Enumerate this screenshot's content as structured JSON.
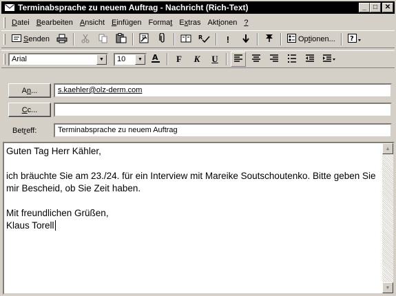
{
  "window": {
    "title": "Terminabsprache zu neuem Auftrag - Nachricht (Rich-Text)",
    "controls": {
      "minimize": "_",
      "maximize": "□",
      "close": "✕"
    }
  },
  "menu": [
    {
      "pre": "",
      "acc": "D",
      "post": "atei"
    },
    {
      "pre": "",
      "acc": "B",
      "post": "earbeiten"
    },
    {
      "pre": "",
      "acc": "A",
      "post": "nsicht"
    },
    {
      "pre": "",
      "acc": "E",
      "post": "infügen"
    },
    {
      "pre": "Forma",
      "acc": "t",
      "post": ""
    },
    {
      "pre": "E",
      "acc": "x",
      "post": "tras"
    },
    {
      "pre": "Akt",
      "acc": "i",
      "post": "onen"
    },
    {
      "pre": "",
      "acc": "?",
      "post": ""
    }
  ],
  "toolbar": {
    "send_pre": "",
    "send_acc": "S",
    "send_post": "enden",
    "options_pre": "Op",
    "options_acc": "t",
    "options_post": "ionen..."
  },
  "format": {
    "font": "Arial",
    "size": "10",
    "bold": "F",
    "italic": "K",
    "underline": "U"
  },
  "header": {
    "to_pre": "A",
    "to_acc": "n",
    "to_post": "...",
    "to_value": "s.kaehler@olz-derm.com",
    "cc_pre": "",
    "cc_acc": "C",
    "cc_post": "c...",
    "cc_value": "",
    "subject_pre": "Bet",
    "subject_acc": "r",
    "subject_post": "eff:",
    "subject_value": "Terminabsprache zu neuem Auftrag"
  },
  "body": {
    "greeting": "Guten Tag Herr Kähler,",
    "paragraph": "ich bräuchte Sie am 23./24. für ein Interview mit Mareike Soutschoutenko. Bitte geben Sie mir Bescheid, ob Sie Zeit haben.",
    "closing": "Mit freundlichen Grüßen,",
    "signature": "Klaus Torell"
  },
  "colors": {
    "titlebar": "#000000",
    "face": "#d4d0c8"
  }
}
